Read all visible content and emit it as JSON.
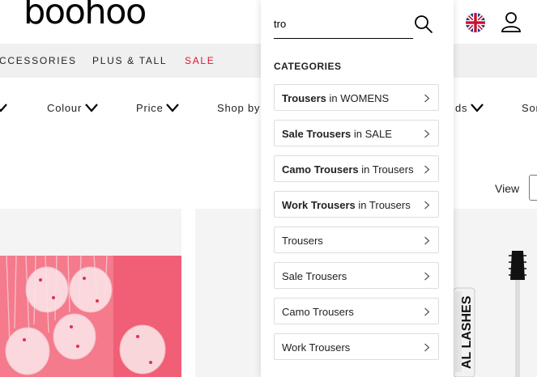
{
  "header": {
    "logo_text": "boohoo",
    "flag_icon": "uk-flag-icon",
    "account_icon": "account-icon"
  },
  "nav": {
    "items": [
      {
        "label": "CCESSORIES"
      },
      {
        "label": "PLUS & TALL"
      },
      {
        "label": "SALE",
        "color": "#e8112d"
      }
    ]
  },
  "filters": {
    "colour": "Colour",
    "price": "Price",
    "shop_by": "Shop by",
    "brands_partial": "ds",
    "sort_partial": "Sor"
  },
  "view": {
    "label": "View"
  },
  "search": {
    "value": "tro",
    "icon": "search-icon",
    "categories_heading": "CATEGORIES",
    "suggestions": [
      {
        "bold": "Trousers",
        "rest": " in WOMENS"
      },
      {
        "bold": "Sale Trousers",
        "rest": " in SALE"
      },
      {
        "bold": "Camo Trousers",
        "rest": " in Trousers"
      },
      {
        "bold": "Work Trousers",
        "rest": " in Trousers"
      },
      {
        "bold": "",
        "rest": "Trousers"
      },
      {
        "bold": "",
        "rest": "Sale Trousers"
      },
      {
        "bold": "",
        "rest": "Camo Trousers"
      },
      {
        "bold": "",
        "rest": "Work Trousers"
      }
    ]
  },
  "colors": {
    "accent_sale": "#e8112d",
    "nav_bg": "#f0f0f0"
  }
}
